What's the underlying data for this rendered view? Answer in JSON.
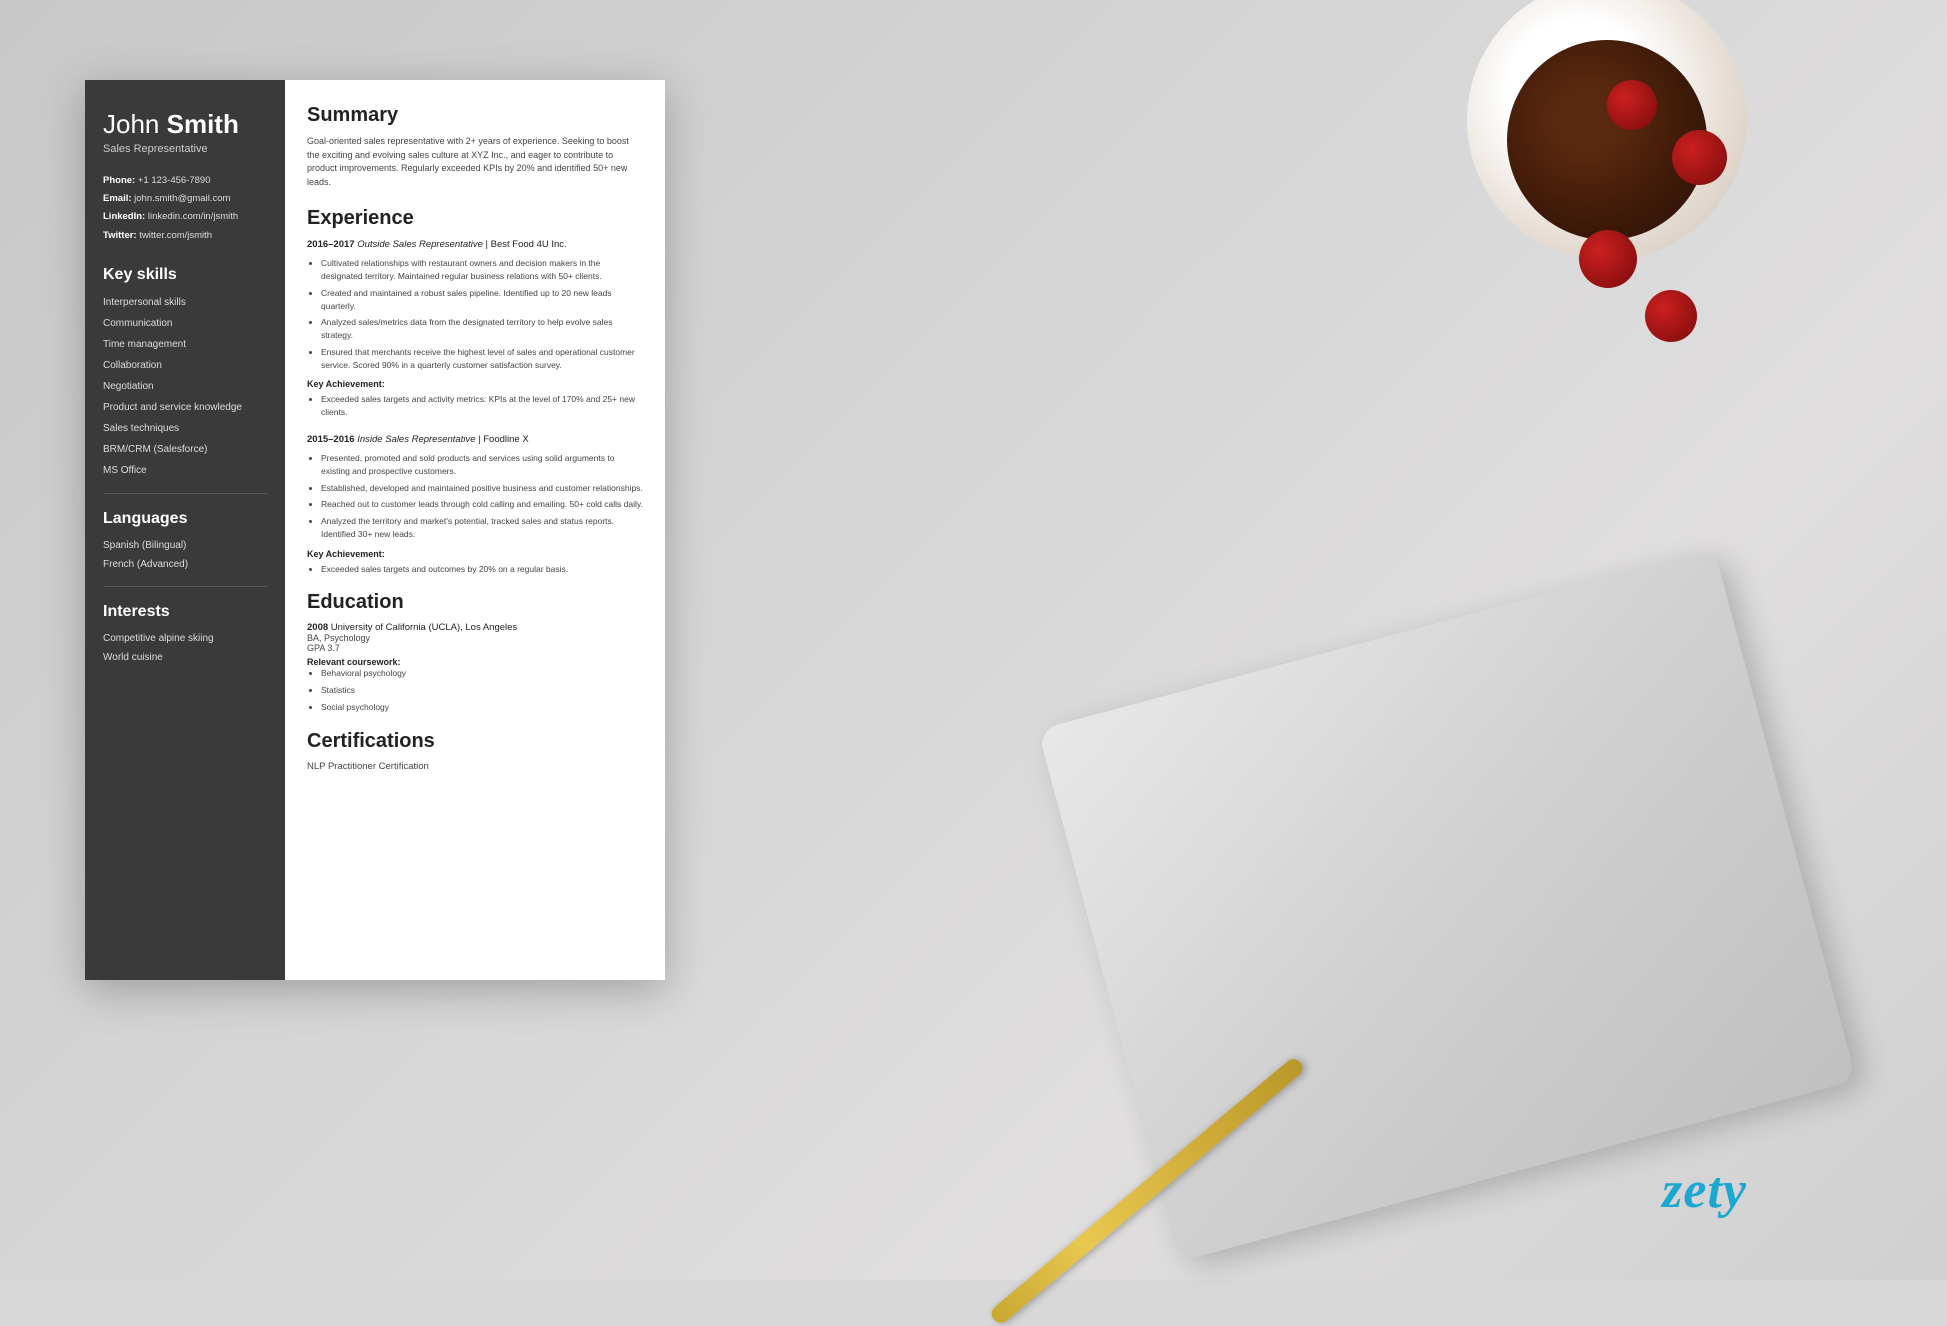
{
  "background": {
    "brand": "zety"
  },
  "resume": {
    "sidebar": {
      "name_first": "John ",
      "name_last": "Smith",
      "title": "Sales Representative",
      "contact": {
        "phone_label": "Phone:",
        "phone": "+1 123-456-7890",
        "email_label": "Email:",
        "email": "john.smith@gmail.com",
        "linkedin_label": "LinkedIn:",
        "linkedin": "linkedin.com/in/jsmith",
        "twitter_label": "Twitter:",
        "twitter": "twitter.com/jsmith"
      },
      "skills_title": "Key skills",
      "skills": [
        "Interpersonal skills",
        "Communication",
        "Time management",
        "Collaboration",
        "Negotiation",
        "Product and service knowledge",
        "Sales techniques",
        "BRM/CRM (Salesforce)",
        "MS Office"
      ],
      "languages_title": "Languages",
      "languages": [
        "Spanish (Bilingual)",
        "French (Advanced)"
      ],
      "interests_title": "Interests",
      "interests": [
        "Competitive alpine skiing",
        "World cuisine"
      ]
    },
    "main": {
      "summary_title": "Summary",
      "summary_text": "Goal-oriented sales representative with 2+ years of experience. Seeking to boost the exciting and evolving sales culture at XYZ Inc., and eager to contribute to product improvements. Regularly exceeded KPIs by 20% and identified 50+ new leads.",
      "experience_title": "Experience",
      "experience": [
        {
          "years": "2016–2017",
          "role": "Outside Sales Representative",
          "company": "Best Food 4U Inc.",
          "bullets": [
            "Cultivated relationships with restaurant owners and decision makers in the designated territory. Maintained regular business relations with 50+ clients.",
            "Created and maintained a robust sales pipeline. Identified up to 20 new leads quarterly.",
            "Analyzed sales/metrics data from the designated territory to help evolve sales strategy.",
            "Ensured that merchants receive the highest level of sales and operational customer service. Scored 90% in a quarterly customer satisfaction survey."
          ],
          "achievement_label": "Key Achievement:",
          "achievement": "Exceeded sales targets and activity metrics: KPIs at the level of 170% and 25+ new clients."
        },
        {
          "years": "2015–2016",
          "role": "Inside Sales Representative",
          "company": "Foodline X",
          "bullets": [
            "Presented, promoted and sold products and services using solid arguments to existing and prospective customers.",
            "Established, developed and maintained positive business and customer relationships.",
            "Reached out to customer leads through cold calling and emailing. 50+ cold calls daily.",
            "Analyzed the territory and market's potential, tracked sales and status reports. Identified 30+ new leads."
          ],
          "achievement_label": "Key Achievement:",
          "achievement": "Exceeded sales targets and outcomes by 20% on a regular basis."
        }
      ],
      "education_title": "Education",
      "education": [
        {
          "year": "2008",
          "school": "University of California (UCLA), Los Angeles",
          "degree": "BA, Psychology",
          "gpa": "GPA 3.7",
          "relevant_label": "Relevant coursework:",
          "coursework": [
            "Behavioral psychology",
            "Statistics",
            "Social psychology"
          ]
        }
      ],
      "certifications_title": "Certifications",
      "certifications": [
        "NLP Practitioner Certification"
      ]
    }
  }
}
